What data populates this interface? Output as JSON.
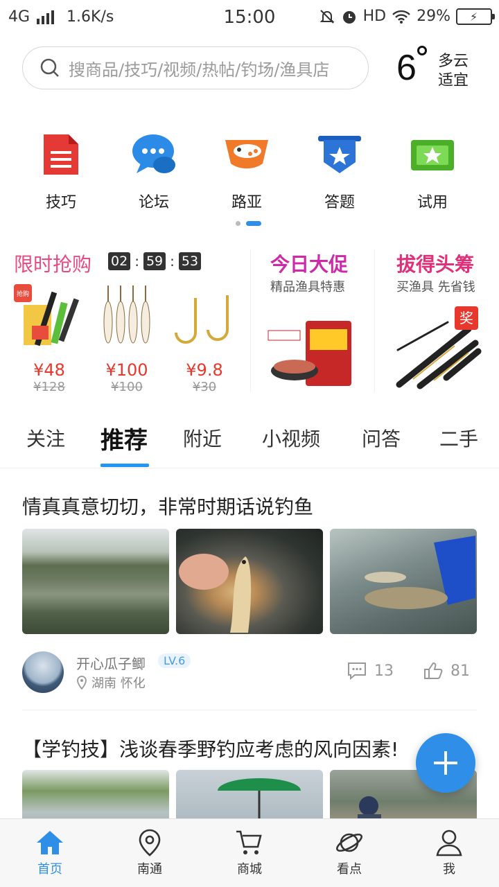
{
  "status": {
    "network": "4G",
    "speed": "1.6K/s",
    "time": "15:00",
    "hd": "HD",
    "battery": "29%"
  },
  "search": {
    "placeholder": "搜商品/技巧/视频/热帖/钓场/渔具店"
  },
  "weather": {
    "temp": "6",
    "cond": "多云",
    "advice": "适宜"
  },
  "quick": [
    {
      "label": "技巧",
      "icon": "document-icon",
      "color": "#e53935"
    },
    {
      "label": "论坛",
      "icon": "chat-bubble-icon",
      "color": "#2b8be6"
    },
    {
      "label": "路亚",
      "icon": "lure-fish-icon",
      "color": "#f07a2a"
    },
    {
      "label": "答题",
      "icon": "star-banner-icon",
      "color": "#2c74d8"
    },
    {
      "label": "试用",
      "icon": "star-ticket-icon",
      "color": "#4caf28"
    }
  ],
  "flash": {
    "title": "限时抢购",
    "timer": [
      "02",
      "59",
      "53"
    ],
    "sep": ":",
    "products": [
      {
        "price": "¥48",
        "original": "¥128"
      },
      {
        "price": "¥100",
        "original": "¥100"
      },
      {
        "price": "¥9.8",
        "original": "¥30"
      }
    ],
    "badge": "抢购"
  },
  "promo": [
    {
      "title": "今日大促",
      "sub": "精品渔具特惠",
      "color": "#cc2aa8"
    },
    {
      "title": "拔得头筹",
      "sub": "买渔具 先省钱",
      "color": "#e0307a",
      "badge": "奖"
    }
  ],
  "tabs": [
    "关注",
    "推荐",
    "附近",
    "小视频",
    "问答",
    "二手"
  ],
  "post1": {
    "title": "情真真意切切，非常时期话说钓鱼",
    "user": "开心瓜子鲫",
    "level": "LV.6",
    "location": "湖南 怀化",
    "comments": "13",
    "likes": "81"
  },
  "post2": {
    "title": "【学钓技】浅谈春季野钓应考虑的风向因素!"
  },
  "nav": [
    "首页",
    "南通",
    "商城",
    "看点",
    "我"
  ],
  "colors": {
    "accent": "#2f8fe8",
    "price": "#e8382d"
  }
}
